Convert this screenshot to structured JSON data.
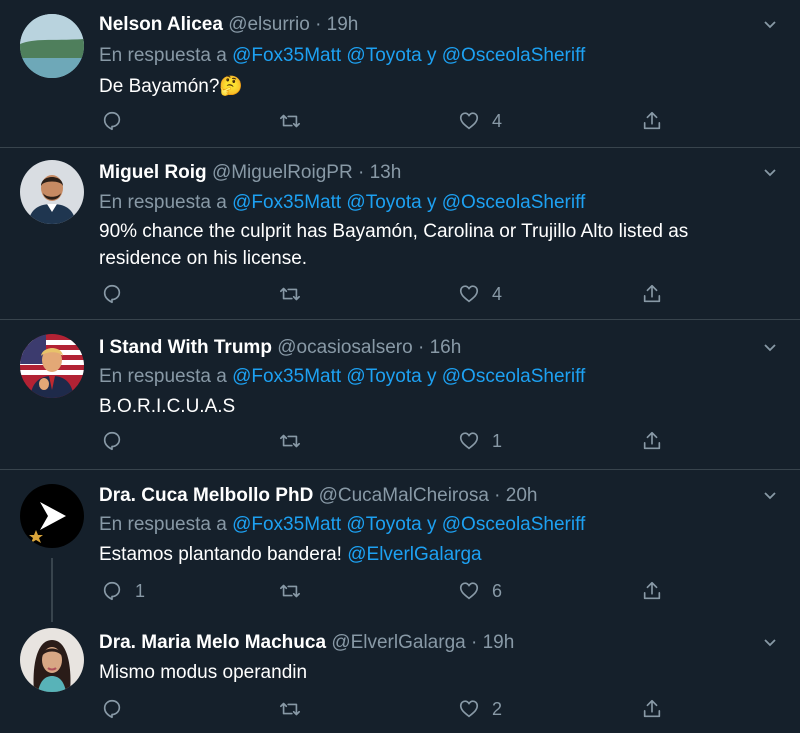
{
  "tweets": [
    {
      "name": "Nelson Alicea",
      "handle": "@elsurrio",
      "sep": "·",
      "time": "19h",
      "reply_prefix": "En respuesta a",
      "mentions": [
        "@Fox35Matt",
        "@Toyota",
        "@OsceolaSheriff"
      ],
      "mention_joiner": "y",
      "text": "De Bayamón?",
      "emoji": "🤔",
      "replies": "",
      "retweets": "",
      "likes": "4"
    },
    {
      "name": "Miguel Roig",
      "handle": "@MiguelRoigPR",
      "sep": "·",
      "time": "13h",
      "reply_prefix": "En respuesta a",
      "mentions": [
        "@Fox35Matt",
        "@Toyota",
        "@OsceolaSheriff"
      ],
      "mention_joiner": "y",
      "text": "90% chance the culprit has Bayamón, Carolina or Trujillo Alto listed as residence on his license.",
      "replies": "",
      "retweets": "",
      "likes": "4"
    },
    {
      "name": "I Stand With Trump",
      "handle": "@ocasiosalsero",
      "sep": "·",
      "time": "16h",
      "reply_prefix": "En respuesta a",
      "mentions": [
        "@Fox35Matt",
        "@Toyota",
        "@OsceolaSheriff"
      ],
      "mention_joiner": "y",
      "text": "B.O.R.I.C.U.A.S",
      "replies": "",
      "retweets": "",
      "likes": "1"
    },
    {
      "name": "Dra. Cuca Melbollo PhD",
      "handle": "@CucaMalCheirosa",
      "sep": "·",
      "time": "20h",
      "reply_prefix": "En respuesta a",
      "mentions": [
        "@Fox35Matt",
        "@Toyota",
        "@OsceolaSheriff"
      ],
      "mention_joiner": "y",
      "text": "Estamos plantando bandera!",
      "text_mention": "@ElverlGalarga",
      "replies": "1",
      "retweets": "",
      "likes": "6"
    },
    {
      "name": "Dra. Maria Melo Machuca",
      "handle": "@ElverlGalarga",
      "sep": "·",
      "time": "19h",
      "text": "Mismo modus operandin",
      "replies": "",
      "retweets": "",
      "likes": "2"
    }
  ],
  "colors": {
    "background": "#15202b",
    "secondary_text": "#8899a6",
    "link": "#1da1f2",
    "divider": "#38444d"
  },
  "icons": [
    "reply-icon",
    "retweet-icon",
    "like-icon",
    "share-icon",
    "chevron-down-icon"
  ]
}
